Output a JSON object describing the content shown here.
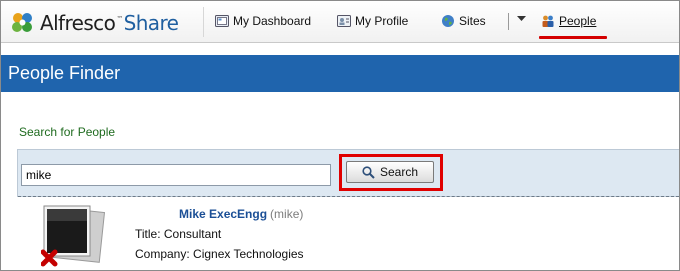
{
  "app": {
    "logo_brand": "Alfresco",
    "logo_product": "Share",
    "logo_tm": "™"
  },
  "nav": {
    "dashboard": "My Dashboard",
    "profile": "My Profile",
    "sites": "Sites",
    "people": "People"
  },
  "page": {
    "title": "People Finder"
  },
  "search": {
    "label": "Search for People",
    "value": "mike",
    "button": "Search"
  },
  "results": [
    {
      "name": "Mike ExecEngg",
      "username": "(mike)",
      "title": "Title: Consultant",
      "company": "Company: Cignex Technologies"
    }
  ],
  "colors": {
    "title_bar": "#1f64ad",
    "highlight": "#e00000",
    "search_panel": "#dde8f2",
    "link": "#1b4f96",
    "label_green": "#1f6b1f"
  },
  "icons": {
    "dashboard": "dashboard-icon",
    "profile": "profile-icon",
    "sites": "globe-icon",
    "people": "people-icon",
    "search": "magnifier-icon",
    "avatar": "no-photo-avatar"
  }
}
